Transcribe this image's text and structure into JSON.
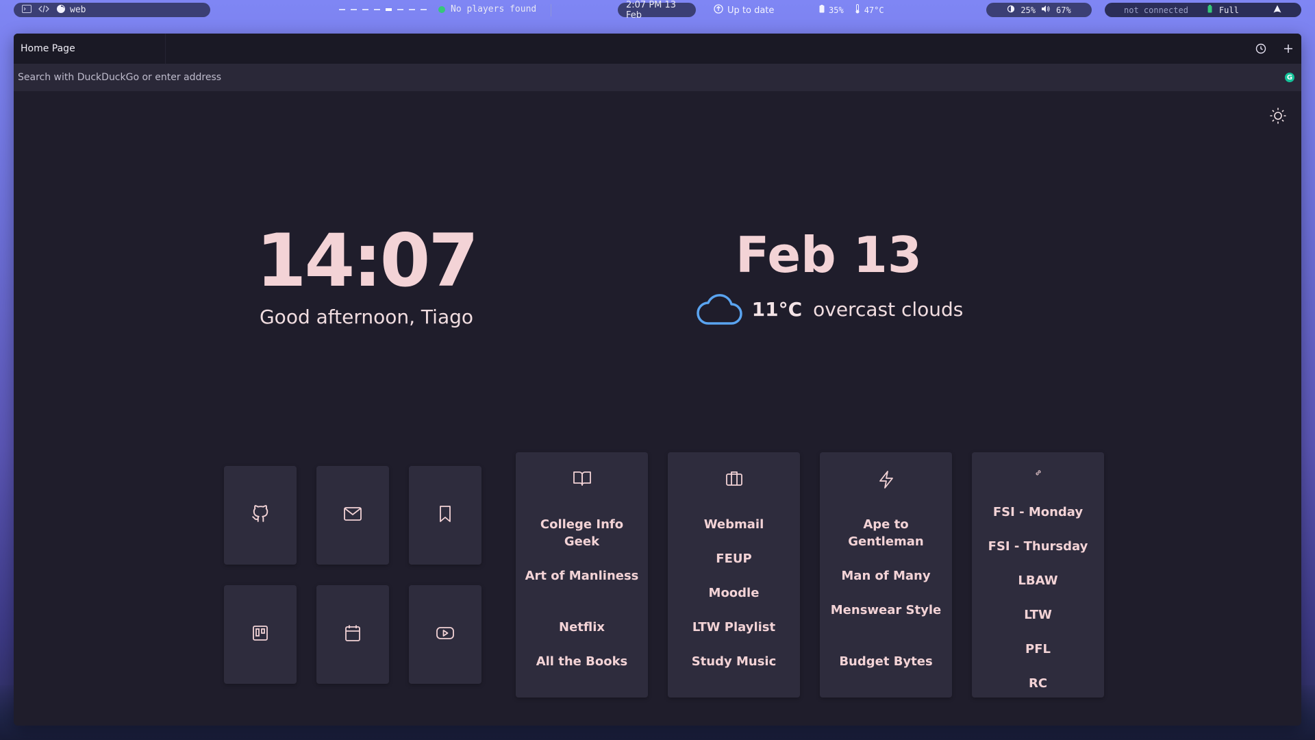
{
  "colors": {
    "accent_text": "#f3d3d6",
    "page_bg": "#1f1d2b",
    "card_bg": "#2e2c3d",
    "weather_icon": "#5aa4f0",
    "status_green": "#36c77a"
  },
  "statusbar": {
    "left_pill": {
      "terminal_icon": "terminal-icon",
      "code_icon": "code-icon",
      "app_icon": "firefox-icon",
      "app_label": "web"
    },
    "media": {
      "text": "No players found"
    },
    "datetime": "2:07 PM 13 Feb",
    "updates": "Up to date",
    "battery": "35%",
    "temperature": "47°C",
    "brightness": "25%",
    "volume": "67%",
    "network": "not connected",
    "power": "Full"
  },
  "browser": {
    "tab_title": "Home Page",
    "address_placeholder": "Search with DuckDuckGo or enter address",
    "address_value": ""
  },
  "home": {
    "time": "14:07",
    "greeting": "Good afternoon, Tiago",
    "date": "Feb 13",
    "weather": {
      "temp": "11°C",
      "description": "overcast clouds",
      "icon": "cloud-icon"
    },
    "quick_links": [
      "github-icon",
      "mail-icon",
      "bookmark-icon",
      "trello-icon",
      "calendar-icon",
      "youtube-icon"
    ],
    "cards": [
      {
        "icon": "book-icon",
        "links": [
          "College Info Geek",
          "Art of Manliness",
          "Netflix",
          "All the Books"
        ]
      },
      {
        "icon": "briefcase-icon",
        "links": [
          "Webmail",
          "FEUP",
          "Moodle",
          "LTW Playlist",
          "Study Music"
        ]
      },
      {
        "icon": "zap-icon",
        "links": [
          "Ape to Gentleman",
          "Man of Many",
          "Menswear Style",
          "Budget Bytes"
        ]
      },
      {
        "icon": "link-icon",
        "links": [
          "FSI - Monday",
          "FSI - Thursday",
          "LBAW",
          "LTW",
          "PFL",
          "RC"
        ]
      }
    ]
  }
}
